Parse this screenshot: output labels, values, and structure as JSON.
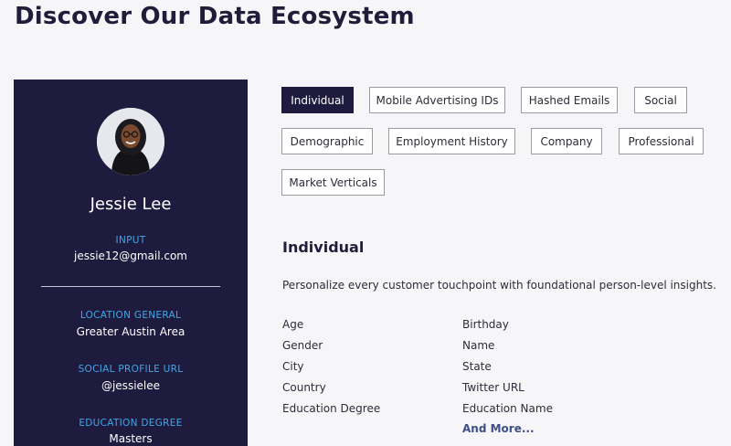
{
  "page": {
    "title": "Discover Our Data Ecosystem"
  },
  "profile": {
    "name": "Jessie Lee",
    "fields": [
      {
        "label": "INPUT",
        "value": "jessie12@gmail.com"
      },
      {
        "label": "LOCATION GENERAL",
        "value": "Greater Austin Area"
      },
      {
        "label": "SOCIAL PROFILE URL",
        "value": "@jessielee"
      },
      {
        "label": "EDUCATION DEGREE",
        "value": "Masters"
      }
    ]
  },
  "tabs": [
    {
      "label": "Individual",
      "active": true
    },
    {
      "label": "Mobile Advertising IDs",
      "active": false
    },
    {
      "label": "Hashed Emails",
      "active": false
    },
    {
      "label": "Social",
      "active": false
    },
    {
      "label": "Demographic",
      "active": false
    },
    {
      "label": "Employment History",
      "active": false
    },
    {
      "label": "Company",
      "active": false
    },
    {
      "label": "Professional",
      "active": false
    },
    {
      "label": "Market Verticals",
      "active": false
    }
  ],
  "section": {
    "title": "Individual",
    "description": "Personalize every customer touchpoint with foundational person-level insights.",
    "attributes_left": [
      "Age",
      "Gender",
      "City",
      "Country",
      "Education Degree"
    ],
    "attributes_right": [
      "Birthday",
      "Name",
      "State",
      "Twitter URL",
      "Education Name"
    ],
    "more_label": "And More..."
  },
  "colors": {
    "card_bg": "#1e1b3f",
    "label_blue": "#3fa8e6",
    "link": "#3c4f86"
  }
}
